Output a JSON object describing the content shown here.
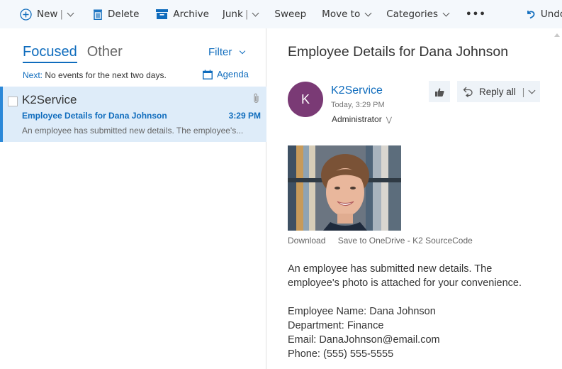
{
  "toolbar": {
    "new": "New",
    "delete": "Delete",
    "archive": "Archive",
    "junk": "Junk",
    "sweep": "Sweep",
    "move_to": "Move to",
    "categories": "Categories",
    "more": "•••",
    "undo": "Undo",
    "icons": {
      "new": "plus-circle-icon",
      "delete": "trash-icon",
      "archive": "archive-icon",
      "undo": "undo-icon"
    }
  },
  "message_list": {
    "tabs": [
      {
        "label": "Focused",
        "active": true
      },
      {
        "label": "Other",
        "active": false
      }
    ],
    "filter": "Filter",
    "next_label": "Next:",
    "next_text": "No events for the next two days.",
    "agenda": "Agenda",
    "messages": [
      {
        "sender": "K2Service",
        "subject": "Employee Details for Dana Johnson",
        "time": "3:29 PM",
        "preview": "An employee has submitted new details. The employee's...",
        "has_attachment": true,
        "selected": true
      }
    ]
  },
  "reading_pane": {
    "title": "Employee Details for Dana Johnson",
    "avatar_initial": "K",
    "avatar_color": "#7a3a75",
    "from": "K2Service",
    "date": "Today, 3:29 PM",
    "to": "Administrator",
    "reply_all": "Reply all",
    "attachment_actions": {
      "download": "Download",
      "save": "Save to OneDrive - K2 SourceCode"
    },
    "body": {
      "intro_line1": "An employee has submitted new details. The",
      "intro_line2": "employee's photo is attached for your convenience.",
      "name": "Employee Name: Dana Johnson",
      "department": "Department: Finance",
      "email": "Email: DanaJohnson@email.com",
      "phone": "Phone: (555) 555-5555"
    }
  },
  "colors": {
    "accent": "#0f6cbd",
    "selected_bg": "#deecf9",
    "toolbar_bg": "#f4f8fc"
  }
}
